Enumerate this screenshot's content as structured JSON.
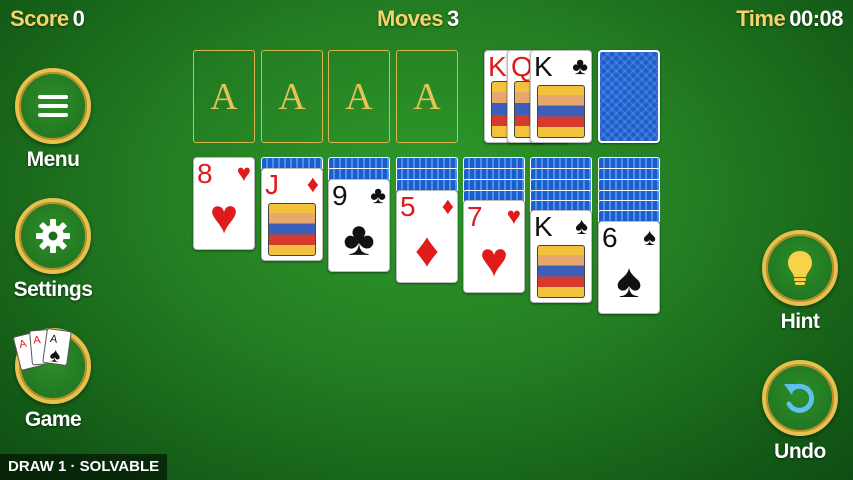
{
  "hud": {
    "score_label": "Score",
    "score_value": "0",
    "moves_label": "Moves",
    "moves_value": "3",
    "time_label": "Time",
    "time_value": "00:08"
  },
  "sidebar_left": {
    "menu_label": "Menu",
    "settings_label": "Settings",
    "game_label": "Game"
  },
  "sidebar_right": {
    "hint_label": "Hint",
    "undo_label": "Undo"
  },
  "footer": {
    "mode": "DRAW 1 · SOLVABLE"
  },
  "foundations": [
    "A",
    "A",
    "A",
    "A"
  ],
  "waste": [
    {
      "rank": "K",
      "suit": "♥"
    },
    {
      "rank": "Q",
      "suit": "♥"
    },
    {
      "rank": "K",
      "suit": "♣"
    }
  ],
  "tableau": [
    {
      "rank": "8",
      "suit": "♥"
    },
    {
      "rank": "J",
      "suit": "♦"
    },
    {
      "rank": "9",
      "suit": "♣"
    },
    {
      "rank": "5",
      "suit": "♦"
    },
    {
      "rank": "7",
      "suit": "♥"
    },
    {
      "rank": "K",
      "suit": "♠"
    },
    {
      "rank": "6",
      "suit": "♠"
    }
  ],
  "colors": {
    "accent_gold": "#e8c04e",
    "felt_green": "#237d22",
    "card_back_blue": "#1b5fcf"
  }
}
